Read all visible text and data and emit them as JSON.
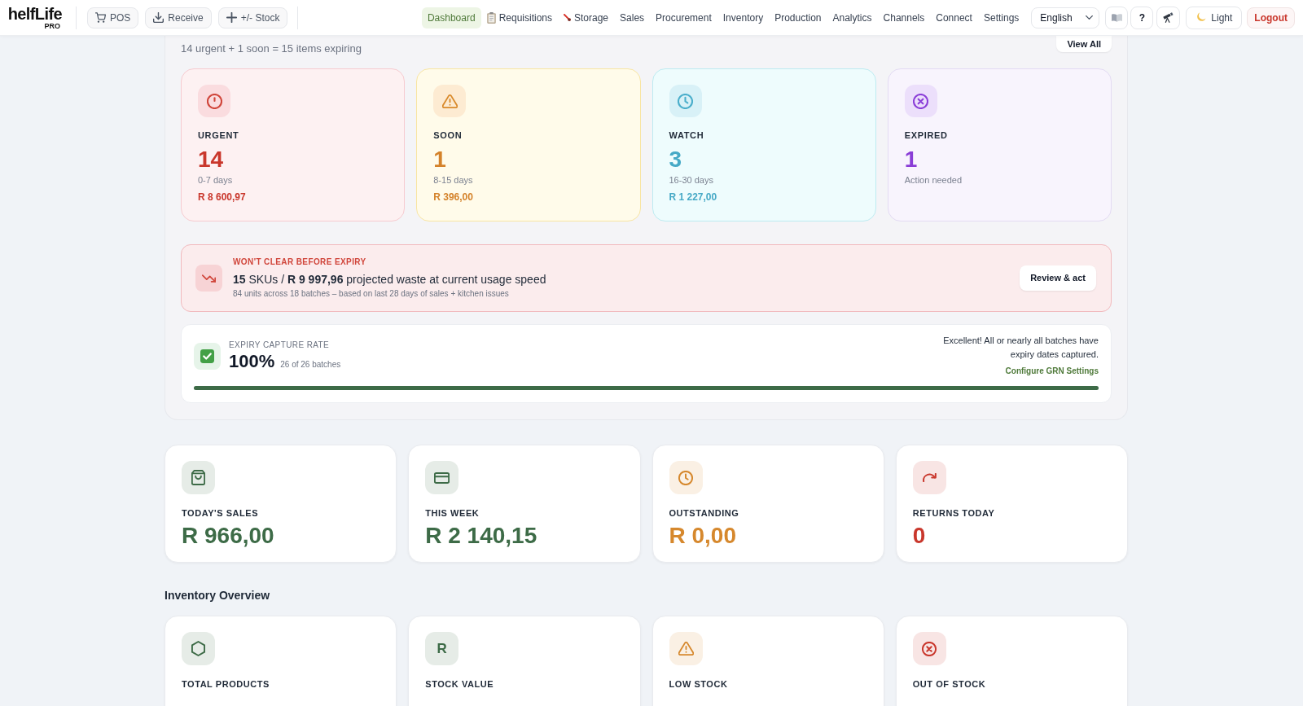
{
  "brand": {
    "name": "helfLife",
    "edition": "PRO"
  },
  "quick_actions": [
    {
      "label": "POS"
    },
    {
      "label": "Receive"
    },
    {
      "label": "+/- Stock"
    }
  ],
  "nav": [
    {
      "label": "Dashboard",
      "selected": true
    },
    {
      "label": "Requisitions",
      "selected": false
    },
    {
      "label": "Storage",
      "selected": false
    },
    {
      "label": "Sales",
      "selected": false
    },
    {
      "label": "Procurement",
      "selected": false
    },
    {
      "label": "Inventory",
      "selected": false
    },
    {
      "label": "Production",
      "selected": false
    },
    {
      "label": "Analytics",
      "selected": false
    },
    {
      "label": "Channels",
      "selected": false
    },
    {
      "label": "Connect",
      "selected": false
    },
    {
      "label": "Settings",
      "selected": false
    }
  ],
  "language": {
    "value": "English"
  },
  "toolbar": {
    "help": "?",
    "theme": "Light",
    "logout": "Logout"
  },
  "expiry": {
    "summary": "14 urgent + 1 soon = 15 items expiring",
    "view_all": "View All",
    "cards": [
      {
        "kind": "urgent",
        "label": "URGENT",
        "count": "14",
        "note": "0-7 days",
        "amount": "R 8 600,97"
      },
      {
        "kind": "soon",
        "label": "SOON",
        "count": "1",
        "note": "8-15 days",
        "amount": "R 396,00"
      },
      {
        "kind": "watch",
        "label": "WATCH",
        "count": "3",
        "note": "16-30 days",
        "amount": "R 1 227,00"
      },
      {
        "kind": "expired",
        "label": "EXPIRED",
        "count": "1",
        "note": "Action needed"
      }
    ],
    "waste_alert": {
      "title": "WON'T CLEAR BEFORE EXPIRY",
      "message": "**15** SKUs / **R 9 997,96** projected waste at current usage speed",
      "detail": "84 units across 18 batches – based on last 28 days of sales + kitchen issues",
      "action": "Review & act"
    },
    "capture": {
      "title": "EXPIRY CAPTURE RATE",
      "value": "100%",
      "detail": "26 of 26 batches",
      "message": "Excellent! All or nearly all batches have expiry dates captured.",
      "link": "Configure GRN Settings",
      "level": 1
    }
  },
  "sales_stats": [
    {
      "label": "TODAY'S SALES",
      "value": "R 966,00",
      "color": "#3d6b47"
    },
    {
      "label": "THIS WEEK",
      "value": "R 2 140,15",
      "color": "#3d6b47"
    },
    {
      "label": "OUTSTANDING",
      "value": "R 0,00",
      "color": "#d6882d"
    },
    {
      "label": "RETURNS TODAY",
      "value": "0",
      "color": "#c9372c"
    }
  ],
  "inventory": {
    "title": "Inventory Overview",
    "cards": [
      {
        "label": "TOTAL PRODUCTS",
        "color": "#3d6b47"
      },
      {
        "label": "STOCK VALUE",
        "symbol": "R",
        "color": "#3d6b47"
      },
      {
        "label": "LOW STOCK",
        "color": "#d6882d"
      },
      {
        "label": "OUT OF STOCK",
        "color": "#c9372c"
      }
    ]
  }
}
